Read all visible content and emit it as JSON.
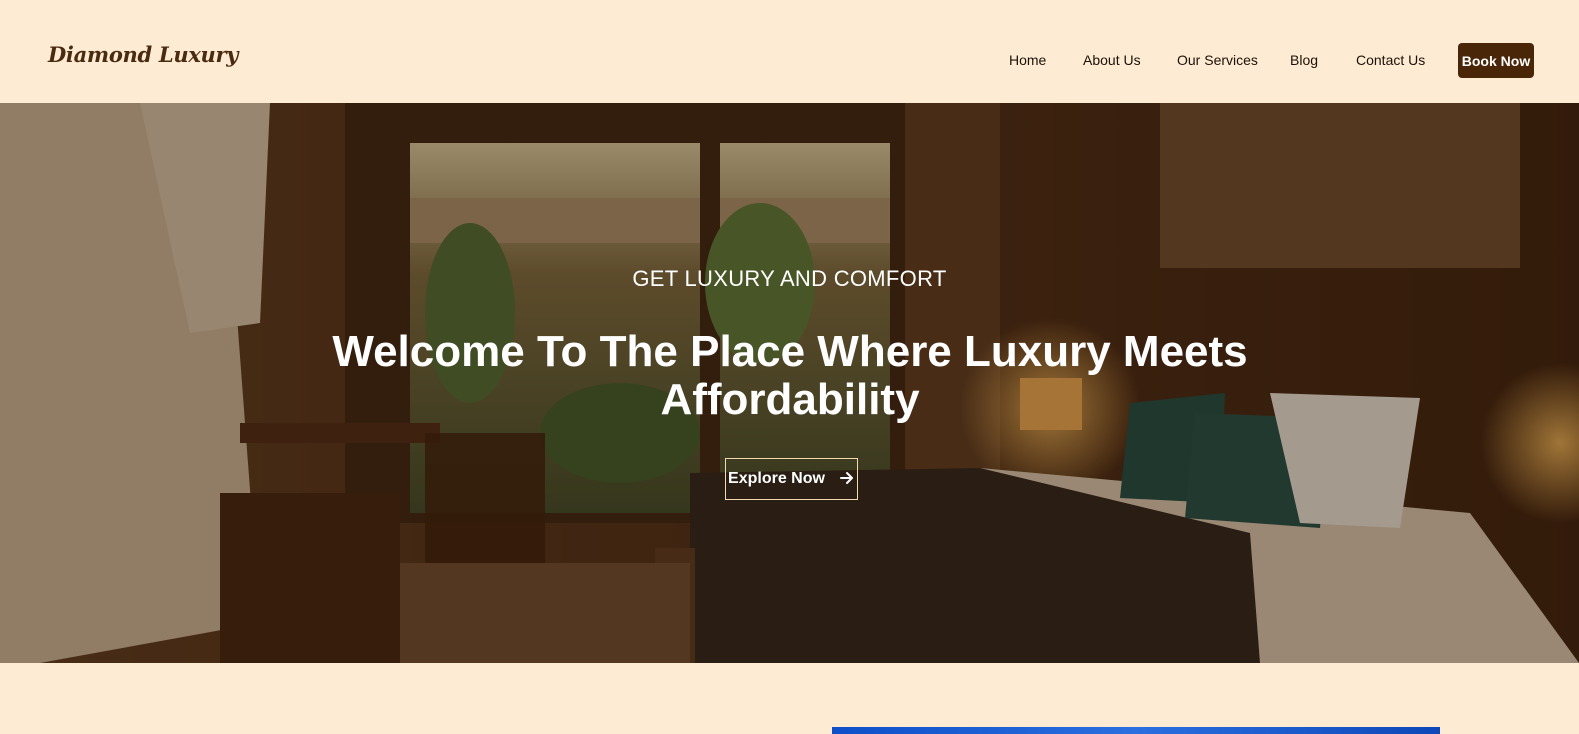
{
  "brand": {
    "logo": "Diamond Luxury"
  },
  "nav": {
    "items": [
      {
        "label": "Home"
      },
      {
        "label": "About Us"
      },
      {
        "label": "Our Services"
      },
      {
        "label": "Blog"
      },
      {
        "label": "Contact Us"
      }
    ],
    "cta_label": "Book Now"
  },
  "hero": {
    "kicker": "GET LUXURY AND COMFORT",
    "title": "Welcome To The Place Where Luxury Meets Affordability",
    "button_label": "Explore Now",
    "button_icon": "arrow-right-icon"
  },
  "colors": {
    "page_bg": "#fdebd3",
    "brand_dark": "#4a2608",
    "accent_border": "#f3d9ae"
  }
}
